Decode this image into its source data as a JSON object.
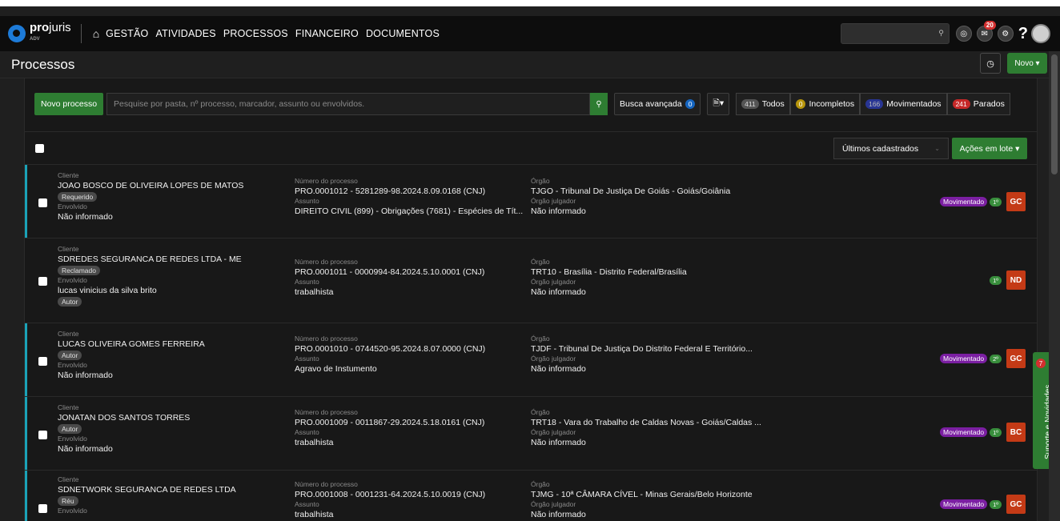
{
  "brand": {
    "name_bold": "pro",
    "name_light": "juris",
    "sub": "ADV",
    "color": "#1d7bd8"
  },
  "nav": {
    "items": [
      "GESTÃO",
      "ATIVIDADES",
      "PROCESSOS",
      "FINANCEIRO",
      "DOCUMENTOS"
    ],
    "notifications": "20",
    "help": "?"
  },
  "page": {
    "title": "Processos",
    "new_label": "Novo ▾"
  },
  "toolbar": {
    "new_process": "Novo processo",
    "search_placeholder": "Pesquise por pasta, nº processo, marcador, assunto ou envolvidos.",
    "advanced": "Busca avançada",
    "advanced_count": "0",
    "filters": [
      {
        "count": "411",
        "label": "Todos"
      },
      {
        "count": "0",
        "label": "Incompletos"
      },
      {
        "count": "166",
        "label": "Movimentados"
      },
      {
        "count": "241",
        "label": "Parados"
      }
    ]
  },
  "list": {
    "sort": "Últimos cadastrados",
    "bulk": "Ações em lote ▾"
  },
  "labels": {
    "client": "Cliente",
    "involved": "Envolvido",
    "number": "Número do processo",
    "subject": "Assunto",
    "organ": "Órgão",
    "judge_organ": "Órgão julgador"
  },
  "rows": [
    {
      "client": "JOAO BOSCO DE OLIVEIRA LOPES DE MATOS",
      "client_tag": "Requerido",
      "involved": "Não informado",
      "involved_tag": "",
      "number": "PRO.0001012 - 5281289-98.2024.8.09.0168 (CNJ)",
      "subject": "DIREITO CIVIL (899) - Obrigações (7681) - Espécies de Tít...",
      "organ": "TJGO - Tribunal De Justiça De Goiás - Goiás/Goiânia",
      "judge_organ": "Não informado",
      "status": "Movimentado",
      "instance": "1º",
      "initials": "GC"
    },
    {
      "client": "SDREDES SEGURANCA DE REDES LTDA - ME",
      "client_tag": "Reclamado",
      "involved": "lucas vinicius da silva brito",
      "involved_tag": "Autor",
      "number": "PRO.0001011 - 0000994-84.2024.5.10.0001 (CNJ)",
      "subject": "trabalhista",
      "organ": "TRT10 - Brasília - Distrito Federal/Brasília",
      "judge_organ": "Não informado",
      "status": "",
      "instance": "1º",
      "initials": "ND"
    },
    {
      "client": "LUCAS OLIVEIRA GOMES FERREIRA",
      "client_tag": "Autor",
      "involved": "Não informado",
      "involved_tag": "",
      "number": "PRO.0001010 - 0744520-95.2024.8.07.0000 (CNJ)",
      "subject": "Agravo de Instumento",
      "organ": "TJDF - Tribunal De Justiça Do Distrito Federal E Território...",
      "judge_organ": "Não informado",
      "status": "Movimentado",
      "instance": "2º",
      "initials": "GC"
    },
    {
      "client": "JONATAN DOS SANTOS TORRES",
      "client_tag": "Autor",
      "involved": "Não informado",
      "involved_tag": "",
      "number": "PRO.0001009 - 0011867-29.2024.5.18.0161 (CNJ)",
      "subject": "trabalhista",
      "organ": "TRT18 - Vara do Trabalho de Caldas Novas - Goiás/Caldas ...",
      "judge_organ": "Não informado",
      "status": "Movimentado",
      "instance": "1º",
      "initials": "BC"
    },
    {
      "client": "SDNETWORK SEGURANCA DE REDES LTDA",
      "client_tag": "Réu",
      "involved": "",
      "involved_tag": "",
      "number": "PRO.0001008 - 0001231-64.2024.5.10.0019 (CNJ)",
      "subject": "trabalhista",
      "organ": "TJMG - 10ª CÂMARA CÍVEL - Minas Gerais/Belo Horizonte",
      "judge_organ": "Não informado",
      "status": "Movimentado",
      "instance": "1º",
      "initials": "GC"
    }
  ],
  "support": {
    "label": "Suporte e Novidades",
    "count": "7"
  },
  "colors": {
    "green": "#2e7d32",
    "accent": "#1aa3b8",
    "status": "#7b1fa2",
    "initials": "#c43a16"
  }
}
